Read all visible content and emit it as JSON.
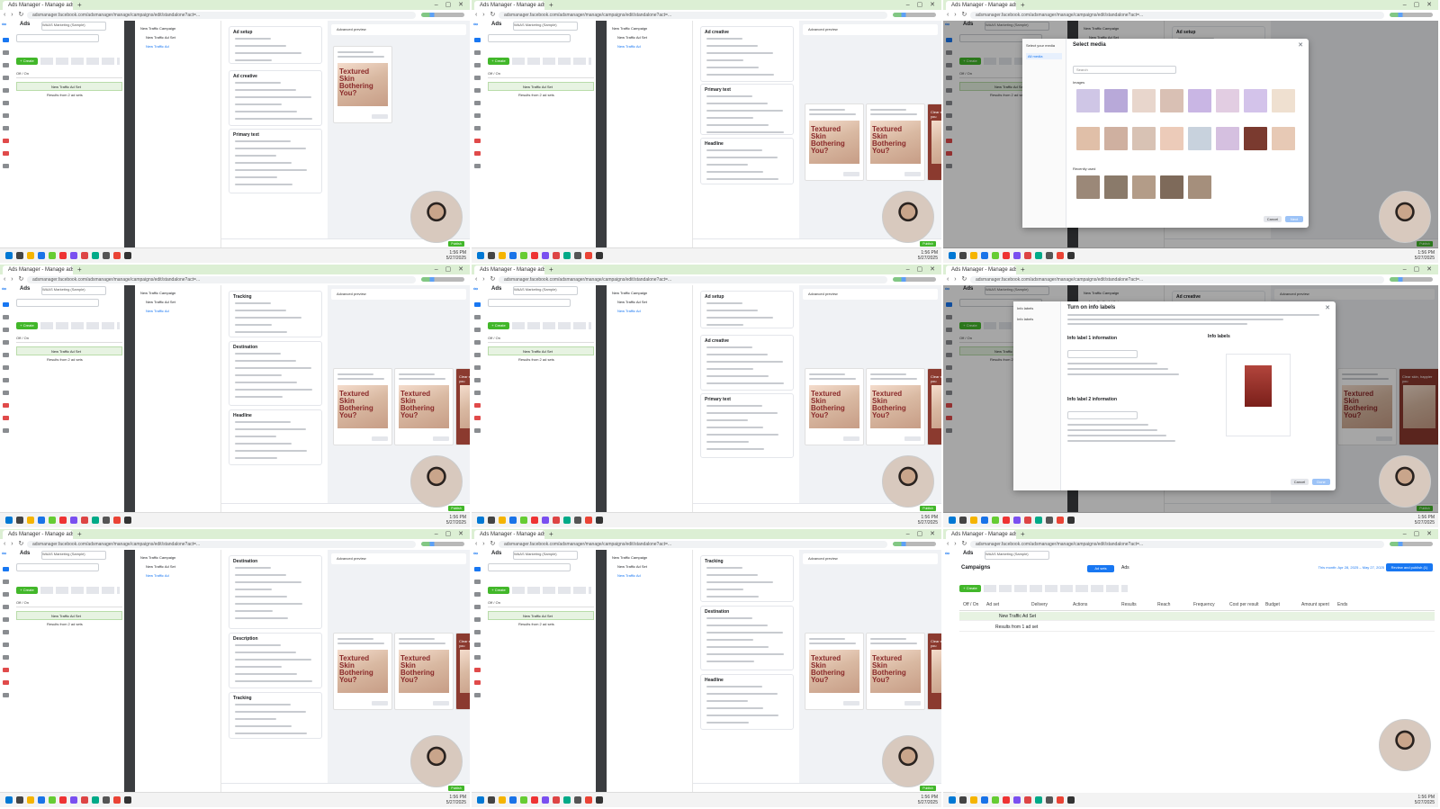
{
  "browser": {
    "tab_title": "Ads Manager - Manage ads",
    "new_tab_icon": "plus-icon",
    "window_controls": "–  ▢  ✕",
    "url": "adsmanager.facebook.com/adsmanager/manage/campaigns/edit/standalone?act=..."
  },
  "ads_manager": {
    "account_label": "Ads",
    "account_selector": "WAAS Marketing (Sample)",
    "create_label": "+ Create",
    "campaign_name": "New Traffic Campaign",
    "adset_name": "New Traffic Ad Set",
    "ad_name": "New Traffic Ad",
    "results_label": "Results from 2 ad sets",
    "off_on_label": "Off / On",
    "publish_label": "Publish",
    "close_label": "Close"
  },
  "editor": {
    "sections": [
      "Ad setup",
      "Ad creative",
      "Destination",
      "Tracking",
      "Primary text",
      "Headline",
      "Description"
    ],
    "multi_advertiser": "Multi-advertiser ads"
  },
  "preview": {
    "header_label": "Advanced preview",
    "ad_overlay_text": "Textured Skin Bothering You?",
    "banner_text": "Clear skin, happier you",
    "shop_now": "Shop now"
  },
  "media_modal": {
    "title": "Select media",
    "sidebar_title": "Select your media",
    "sidebar_item": "All media",
    "search_placeholder": "Search",
    "cancel_label": "Cancel",
    "next_label": "Next",
    "recent_label": "Recently used",
    "images_label": "Images"
  },
  "info_modal": {
    "sidebar_title": "Info labels",
    "sidebar_item": "Info labels",
    "title": "Turn on info labels",
    "section1": "Info label 1 information",
    "section2": "Info label 2 information",
    "preview_title": "Info labels",
    "cancel_label": "Cancel",
    "apply_label": "Done"
  },
  "table_view": {
    "tab_campaigns": "Campaigns",
    "tab_adsets": "Ad sets",
    "tab_ads": "Ads",
    "date_range": "This month: Apr 28, 2025 – May 27, 2025",
    "review_publish": "Review and publish (1)",
    "columns": [
      "Off / On",
      "Ad set",
      "Delivery",
      "Actions",
      "Results",
      "Reach",
      "Frequency",
      "Cost per result",
      "Budget",
      "Amount spent",
      "Ends"
    ],
    "row1": "New Traffic Ad Set",
    "row2": "Results from 1 ad set"
  },
  "taskbar": {
    "time": "1:56 PM",
    "date": "5/27/2025"
  },
  "colors": {
    "tab_bar": "#dcefd4",
    "fb_blue": "#1877f2",
    "publish_green": "#42b72a",
    "selected_row": "#e7f3e2",
    "dark_divider": "#3b3d40"
  }
}
